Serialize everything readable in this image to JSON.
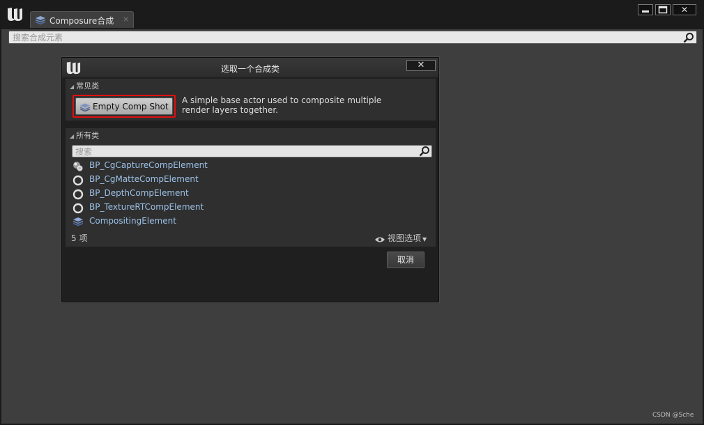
{
  "app": {
    "tab_label": "Composure合成",
    "tab_close": "×",
    "win_min": "▬",
    "win_max": "▭",
    "win_close": "✕"
  },
  "search": {
    "placeholder": "搜索合成元素"
  },
  "dialog": {
    "title": "选取一个合成类",
    "close": "✕",
    "common_section": {
      "header": "常见类",
      "button_label": "Empty Comp Shot",
      "description": "A simple base actor used to composite multiple render layers together."
    },
    "all_section": {
      "header": "所有类",
      "search_placeholder": "搜索",
      "items": [
        {
          "label": "BP_CgCaptureCompElement",
          "icon": "capture-sphere-icon"
        },
        {
          "label": "BP_CgMatteCompElement",
          "icon": "circle-icon"
        },
        {
          "label": "BP_DepthCompElement",
          "icon": "circle-icon"
        },
        {
          "label": "BP_TextureRTCompElement",
          "icon": "circle-icon"
        },
        {
          "label": "CompositingElement",
          "icon": "layers-icon"
        }
      ],
      "count": "5 项",
      "view_options": "视图选项"
    },
    "cancel": "取消"
  },
  "watermark": "CSDN @Sche",
  "colors": {
    "accent_link": "#9bc0e6",
    "highlight_border": "#e01010"
  }
}
